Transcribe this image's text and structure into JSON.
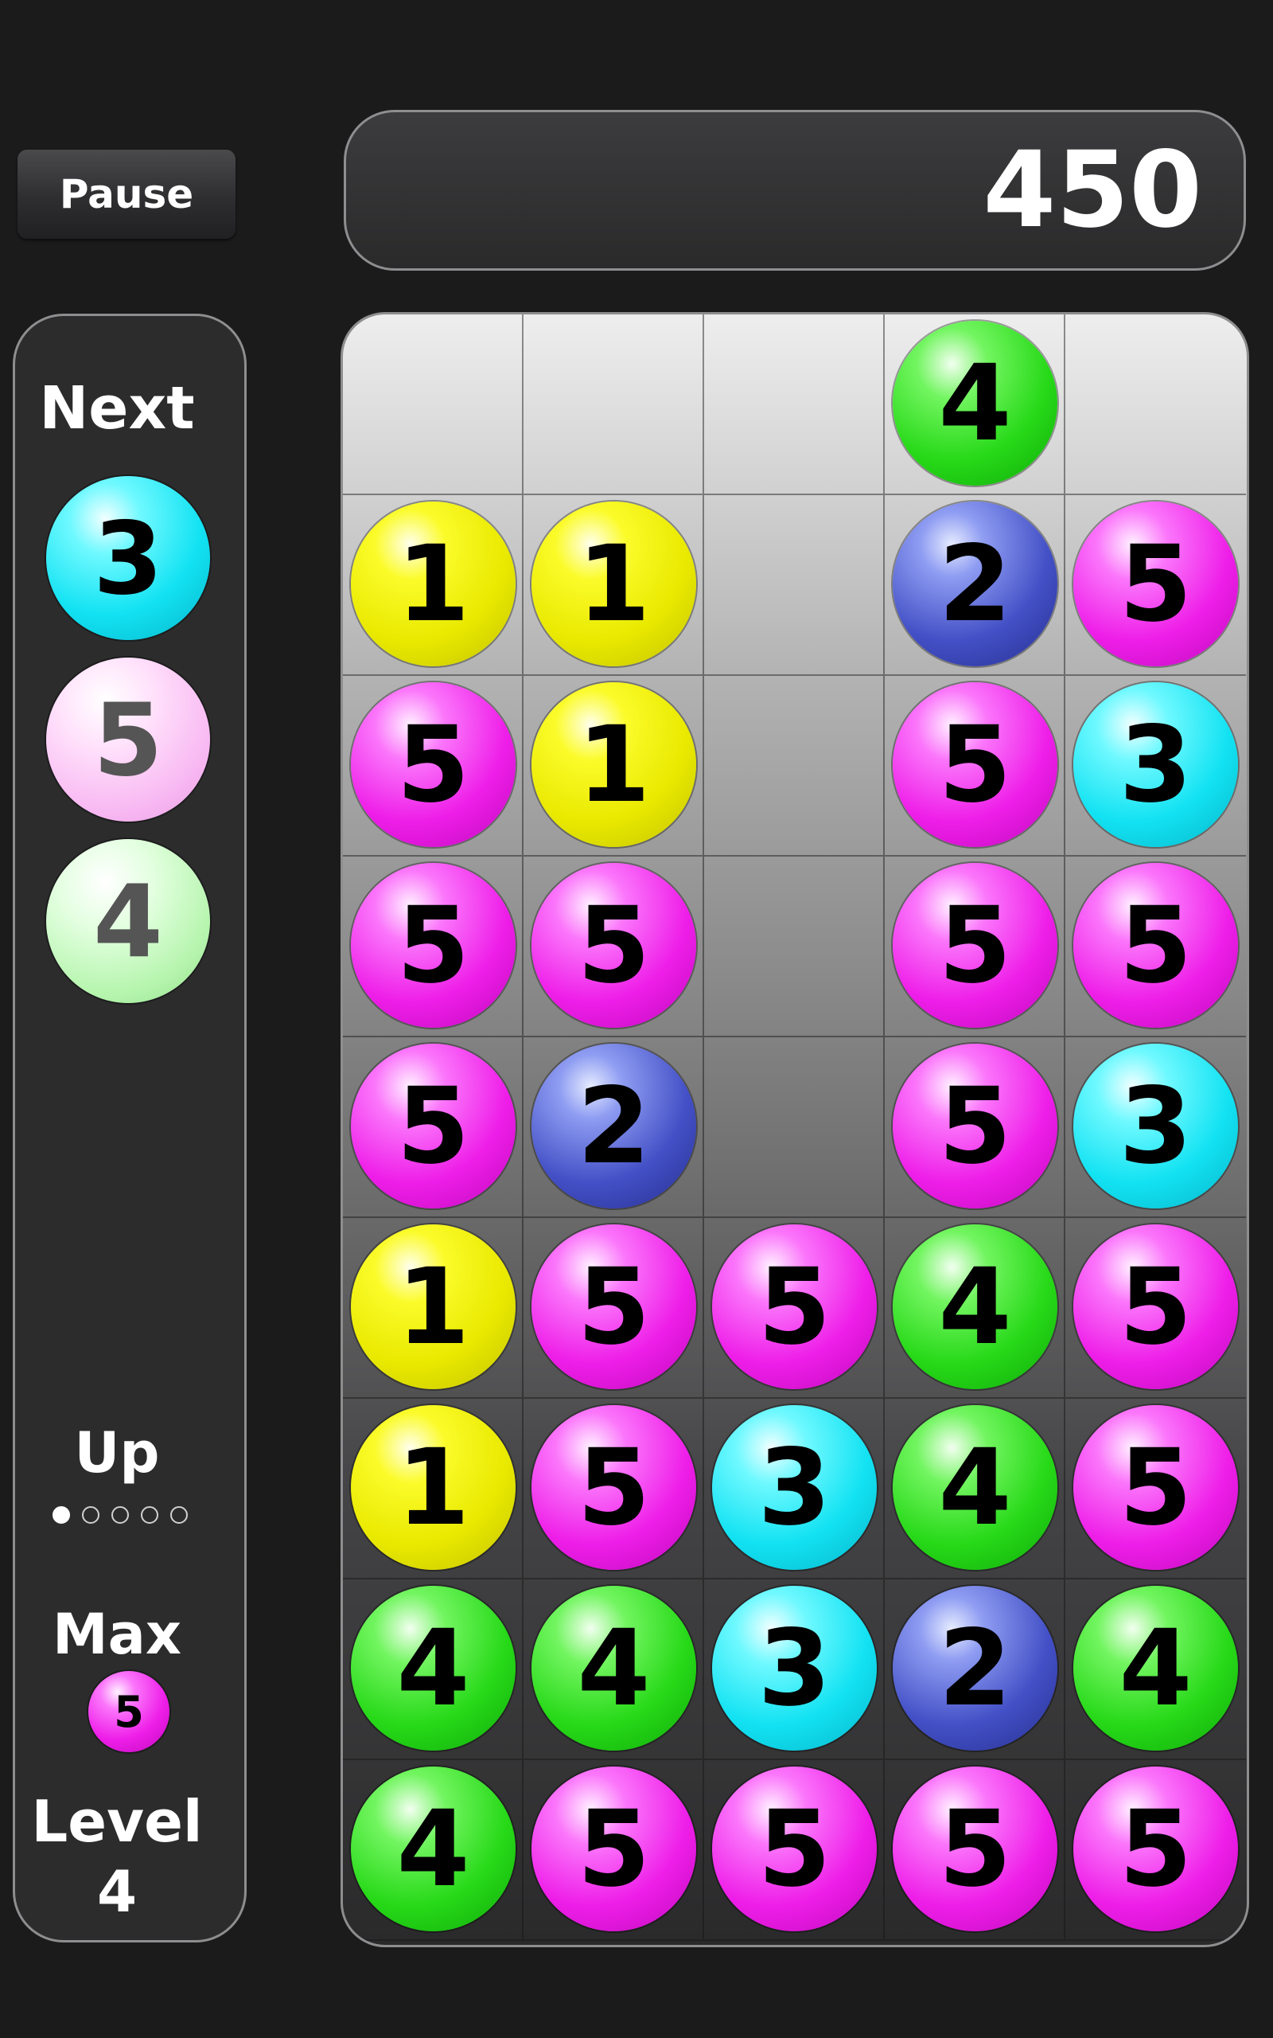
{
  "controls": {
    "pause_label": "Pause"
  },
  "score": "450",
  "side": {
    "next_label": "Next",
    "next": [
      {
        "value": "3",
        "color": "#12e2f2"
      },
      {
        "value": "5",
        "color": "#f8b8f2"
      },
      {
        "value": "4",
        "color": "#b6f5ae"
      }
    ],
    "up_label": "Up",
    "up_progress": {
      "filled": 1,
      "total": 5
    },
    "max_label": "Max",
    "max_value": "5",
    "level_label": "Level",
    "level_value": "4"
  },
  "board": {
    "columns": 5,
    "rows": 9,
    "cells": [
      [
        "",
        "",
        "",
        "4",
        ""
      ],
      [
        "1",
        "1",
        "",
        "2",
        "5"
      ],
      [
        "5",
        "1",
        "",
        "5",
        "3"
      ],
      [
        "5",
        "5",
        "",
        "5",
        "5"
      ],
      [
        "5",
        "2",
        "",
        "5",
        "3"
      ],
      [
        "1",
        "5",
        "5",
        "4",
        "5"
      ],
      [
        "1",
        "5",
        "3",
        "4",
        "5"
      ],
      [
        "4",
        "4",
        "3",
        "2",
        "4"
      ],
      [
        "4",
        "5",
        "5",
        "5",
        "5"
      ]
    ]
  },
  "ball_colors": {
    "1": "#e9e900",
    "2": "#4350c6",
    "3": "#12e2f2",
    "4": "#27d918",
    "5": "#ee1ee8"
  }
}
